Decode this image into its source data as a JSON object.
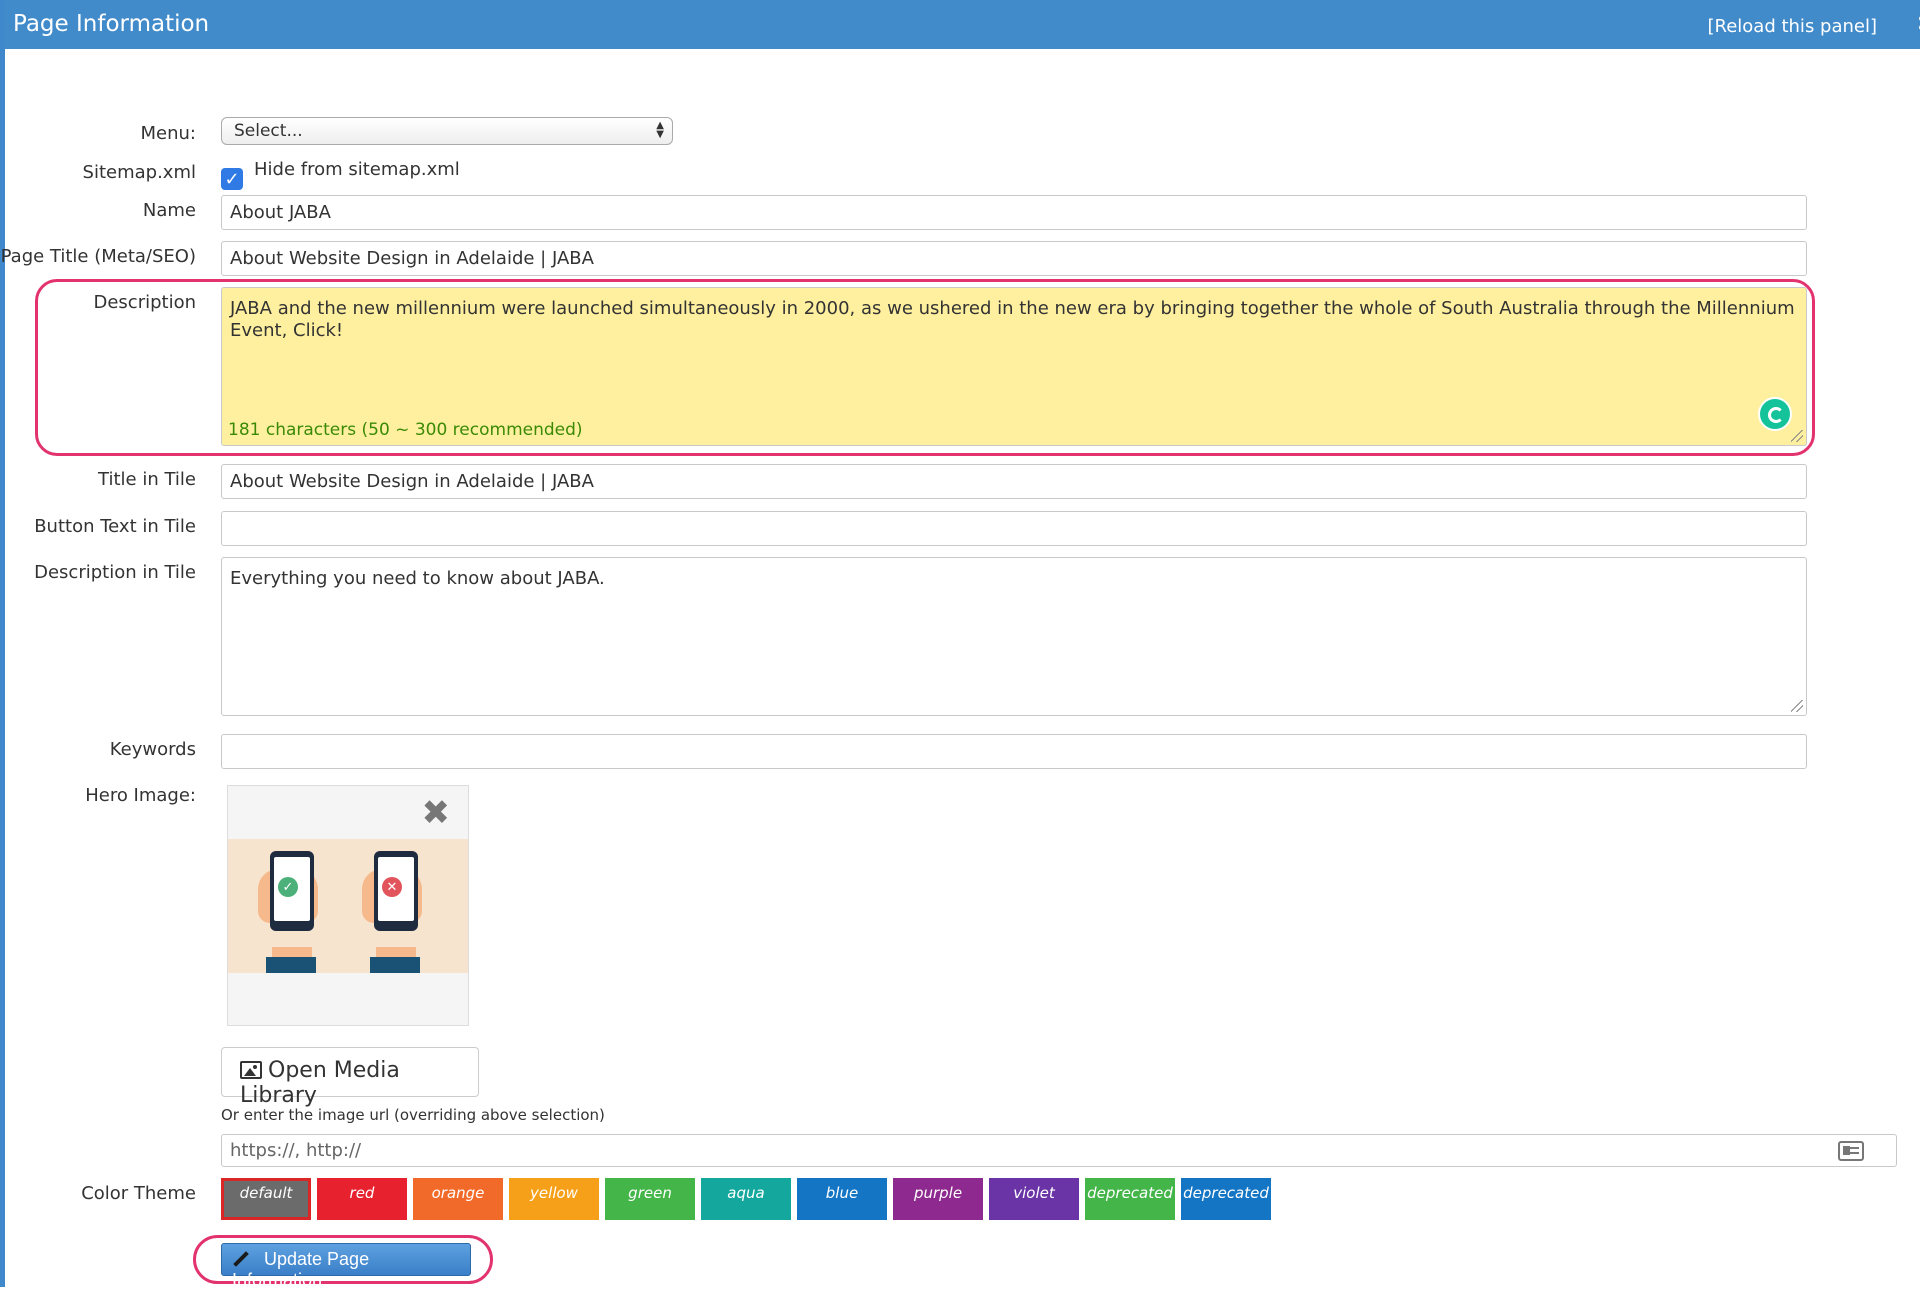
{
  "header": {
    "title": "Page Information",
    "reload": "[Reload this panel]"
  },
  "form": {
    "menu_label": "Menu:",
    "menu_value": "Select...",
    "sitemap_label": "Sitemap.xml",
    "sitemap_checkbox_label": "Hide from sitemap.xml",
    "sitemap_checked": true,
    "name_label": "Name",
    "name_value": "About JABA",
    "page_title_label": "Page Title (Meta/SEO)",
    "page_title_value": "About Website Design in Adelaide | JABA",
    "description_label": "Description",
    "description_value": "JABA and the new millennium were launched simultaneously in 2000, as we ushered in the new era by bringing together the whole of South Australia through the Millennium Event, Click!",
    "description_count": "181 characters (50 ~ 300 recommended)",
    "title_in_tile_label": "Title in Tile",
    "title_in_tile_value": "About Website Design in Adelaide | JABA",
    "button_text_label": "Button Text in Tile",
    "button_text_value": "",
    "description_tile_label": "Description in Tile",
    "description_tile_value": "Everything you need to know about JABA.",
    "keywords_label": "Keywords",
    "keywords_value": "",
    "hero_label": "Hero Image:",
    "open_media_label": "Open Media Library",
    "url_hint": "Or enter the image url (overriding above selection)",
    "url_placeholder": "https://, http://",
    "color_theme_label": "Color Theme",
    "update_label": "Update Page Information"
  },
  "themes": [
    {
      "label": "default",
      "color": "#6b6b6b",
      "selected": true
    },
    {
      "label": "red",
      "color": "#e8212f"
    },
    {
      "label": "orange",
      "color": "#f26a2a"
    },
    {
      "label": "yellow",
      "color": "#f6a01a"
    },
    {
      "label": "green",
      "color": "#43b549"
    },
    {
      "label": "aqua",
      "color": "#13a79d"
    },
    {
      "label": "blue",
      "color": "#1475c4"
    },
    {
      "label": "purple",
      "color": "#8e2a8f"
    },
    {
      "label": "violet",
      "color": "#6a33a6"
    },
    {
      "label": "deprecated",
      "color": "#43b549"
    },
    {
      "label": "deprecated",
      "color": "#1475c4"
    }
  ],
  "colors": {
    "header_bg": "#428bca",
    "highlight": "#e2336f",
    "description_bg": "#fff0a0",
    "count_text": "#3a8a06"
  },
  "icons": [
    "image-icon",
    "close-icon",
    "pencil-icon",
    "id-card-icon",
    "grammarly-icon",
    "checkmark-icon",
    "select-arrows-icon"
  ]
}
